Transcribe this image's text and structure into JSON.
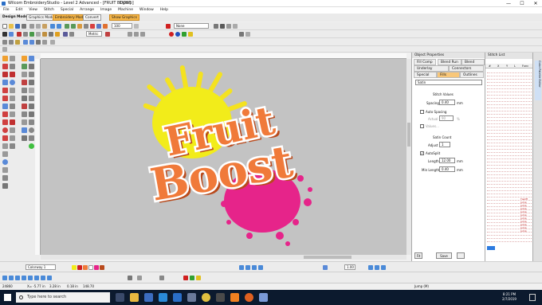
{
  "window": {
    "title": "Wilcom EmbroideryStudio - Level 2 Advanced - [FRUIT BOOST",
    "title_file": "1\\jimp]",
    "minimize": "—",
    "maximize": "☐",
    "close": "✕"
  },
  "menu": [
    "File",
    "Edit",
    "View",
    "Stitch",
    "Special",
    "Arrange",
    "Image",
    "Machine",
    "Window",
    "Help"
  ],
  "modebar": {
    "label": "Design Mode:",
    "graphics_mode": "Graphics Mode",
    "embroidery_mode": "Embroidery Mode",
    "convert": "Convert",
    "show_graphics": "Show Graphics"
  },
  "toolbar": {
    "zoom_value": "100",
    "color_field": "None",
    "units": "Metric"
  },
  "bottom_toolbar": {
    "colorway": "Colorway 1",
    "zoom_value": "1.00"
  },
  "design": {
    "word1": "Fruit",
    "word2": "Boost",
    "colors": {
      "sun": "#f2ec1a",
      "sun_ray": "#f4e220",
      "splash": "#e6248a",
      "text_fill": "#f07a3a",
      "text_outline": "#ffffff",
      "text_shadow": "#b94a1c",
      "canvas": "#c3c3c3"
    }
  },
  "object_properties": {
    "title": "Object Properties",
    "tabs_row1": [
      "Fill Comp",
      "Blend Run",
      "Blend Fills"
    ],
    "tabs_row2": [
      "Underlay",
      "Connectors"
    ],
    "tabs_row3": [
      "Special",
      "Fills",
      "Outlines"
    ],
    "fill_type": "Satin",
    "stitch_values_heading": "Stitch Values",
    "spacing_label": "Spacing",
    "spacing_value": "0.40",
    "spacing_unit": "mm",
    "auto_spacing_label": "Auto Spacing",
    "actual_label": "Actual",
    "actual_value": "90",
    "actual_unit": "%",
    "values_label": "Values...",
    "satin_count_heading": "Satin Count",
    "adjust_label": "Adjust",
    "adjust_value": "1",
    "autosplit_label": "AutoSplit",
    "length_label": "Length",
    "length_value": "12.00",
    "length_unit": "mm",
    "min_length_label": "Min Length",
    "min_length_value": "0.40",
    "min_length_unit": "mm",
    "save_button": "Save",
    "fit_button": "Fit"
  },
  "stitch_list": {
    "title": "Stitch List",
    "columns": [
      "#",
      "X",
      "Y",
      "L",
      "Func"
    ],
    "red_func_entries": [
      "TieOff",
      "Jump",
      "Jump",
      "Jump",
      "Jump",
      "Jump",
      "Jump",
      "Jump",
      "Jump",
      "Jump",
      "Jump"
    ]
  },
  "side_panel_label": "Color Palette Editor",
  "status": {
    "stitches": "24860",
    "x": "X= -5.77 in",
    "y": "3.28 in",
    "l": "0.18 in",
    "angle": "148.70",
    "jump": "Jump (M)"
  },
  "taskbar": {
    "search_placeholder": "Type here to search",
    "time": "8:21 PM",
    "date": "2/7/2019"
  }
}
